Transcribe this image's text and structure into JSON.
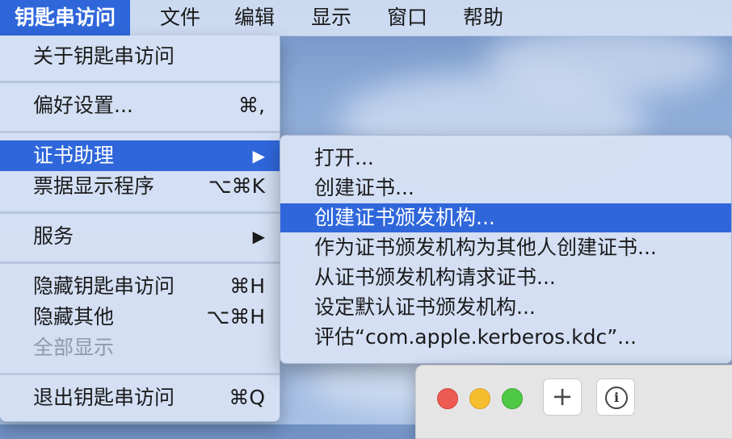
{
  "menubar": {
    "items": [
      "钥匙串访问",
      "文件",
      "编辑",
      "显示",
      "窗口",
      "帮助"
    ]
  },
  "app_menu": {
    "about": "关于钥匙串访问",
    "preferences": {
      "label": "偏好设置...",
      "shortcut": "⌘,"
    },
    "certificate_assistant": {
      "label": "证书助理",
      "arrow": "▶"
    },
    "ticket_viewer": {
      "label": "票据显示程序",
      "shortcut": "⌥⌘K"
    },
    "services": {
      "label": "服务",
      "arrow": "▶"
    },
    "hide": {
      "label": "隐藏钥匙串访问",
      "shortcut": "⌘H"
    },
    "hide_others": {
      "label": "隐藏其他",
      "shortcut": "⌥⌘H"
    },
    "show_all": "全部显示",
    "quit": {
      "label": "退出钥匙串访问",
      "shortcut": "⌘Q"
    }
  },
  "certificate_submenu": {
    "items": [
      "打开...",
      "创建证书...",
      "创建证书颁发机构...",
      "作为证书颁发机构为其他人创建证书...",
      "从证书颁发机构请求证书...",
      "设定默认证书颁发机构...",
      "评估“com.apple.kerberos.kdc”..."
    ],
    "highlighted_index": 2
  },
  "window": {
    "add_button": "+",
    "info_button": "i",
    "icons": [
      "close-icon",
      "minimize-icon",
      "zoom-icon",
      "add-icon",
      "info-icon"
    ]
  },
  "colors": {
    "accent": "#2f67db",
    "menu_background": "#d4e0f4",
    "disabled_text": "#8e99ab"
  }
}
